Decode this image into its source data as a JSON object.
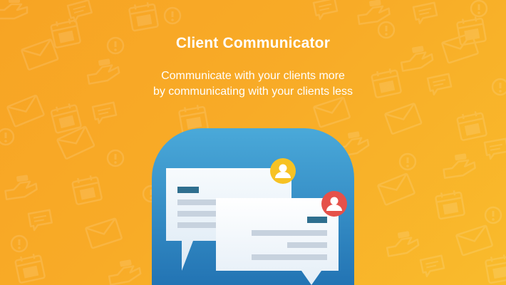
{
  "banner": {
    "title": "Client Communicator",
    "subtitle_line1": "Communicate with your clients more",
    "subtitle_line2": "by communicating with your clients less"
  },
  "colors": {
    "background_start": "#f7a424",
    "background_end": "#f9bb2c",
    "icon_gradient_top": "#4aa9d9",
    "icon_gradient_bottom": "#1f6fb0",
    "avatar_yellow": "#f7c223",
    "avatar_red": "#e5514a",
    "accent_bar": "#2f6f8f"
  },
  "icons": [
    "calendar-icon",
    "envelope-icon",
    "hand-icon",
    "alert-icon",
    "chat-bubble-icon",
    "user-avatar-icon"
  ]
}
